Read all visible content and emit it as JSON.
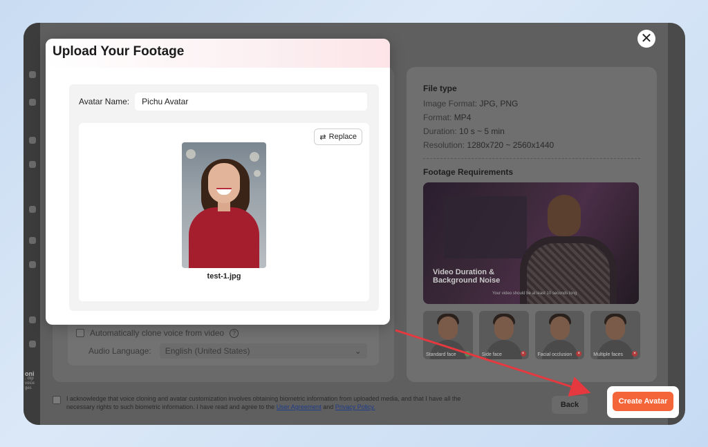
{
  "modal": {
    "close_label": "✕"
  },
  "upload": {
    "title": "Upload Your Footage",
    "avatar_name_label": "Avatar Name:",
    "avatar_name_value": "Pichu Avatar",
    "replace_label": "Replace",
    "filename": "test-1.jpg"
  },
  "voice": {
    "clone_label": "Automatically clone voice from video",
    "audio_language_label": "Audio Language:",
    "audio_language_value": "English (United States)"
  },
  "file_type": {
    "title": "File type",
    "lines": [
      {
        "key": "Image Format:",
        "value": "JPG, PNG"
      },
      {
        "key": "Format:",
        "value": "MP4"
      },
      {
        "key": "Duration:",
        "value": "10 s ~ 5 min"
      },
      {
        "key": "Resolution:",
        "value": "1280x720 ~ 2560x1440"
      }
    ]
  },
  "requirements": {
    "title": "Footage Requirements",
    "video_caption_line1": "Video Duration &",
    "video_caption_line2": "Background Noise",
    "video_subcaption": "Your video should be at least 10 seconds long",
    "thumbs": [
      {
        "label": "Standard face",
        "status": "ok"
      },
      {
        "label": "Side face",
        "status": "bad"
      },
      {
        "label": "Facial occlusion",
        "status": "bad"
      },
      {
        "label": "Multiple faces",
        "status": "bad"
      }
    ]
  },
  "footer": {
    "ack_text": "I acknowledge that voice cloning and avatar customization involves obtaining biometric information from uploaded media, and that I have all the necessary rights to such biometric information. I have read and agree to the",
    "user_agreement": "User Agreement",
    "and": "and",
    "privacy_policy": "Privacy Policy.",
    "back_label": "Back",
    "create_label": "Create Avatar"
  },
  "sidebar_snippet": {
    "title": "oni",
    "line1": ", digi",
    "line2": "voice",
    "line3": "ges"
  },
  "colors": {
    "accent": "#f4653a",
    "arrow": "#e5393f"
  }
}
